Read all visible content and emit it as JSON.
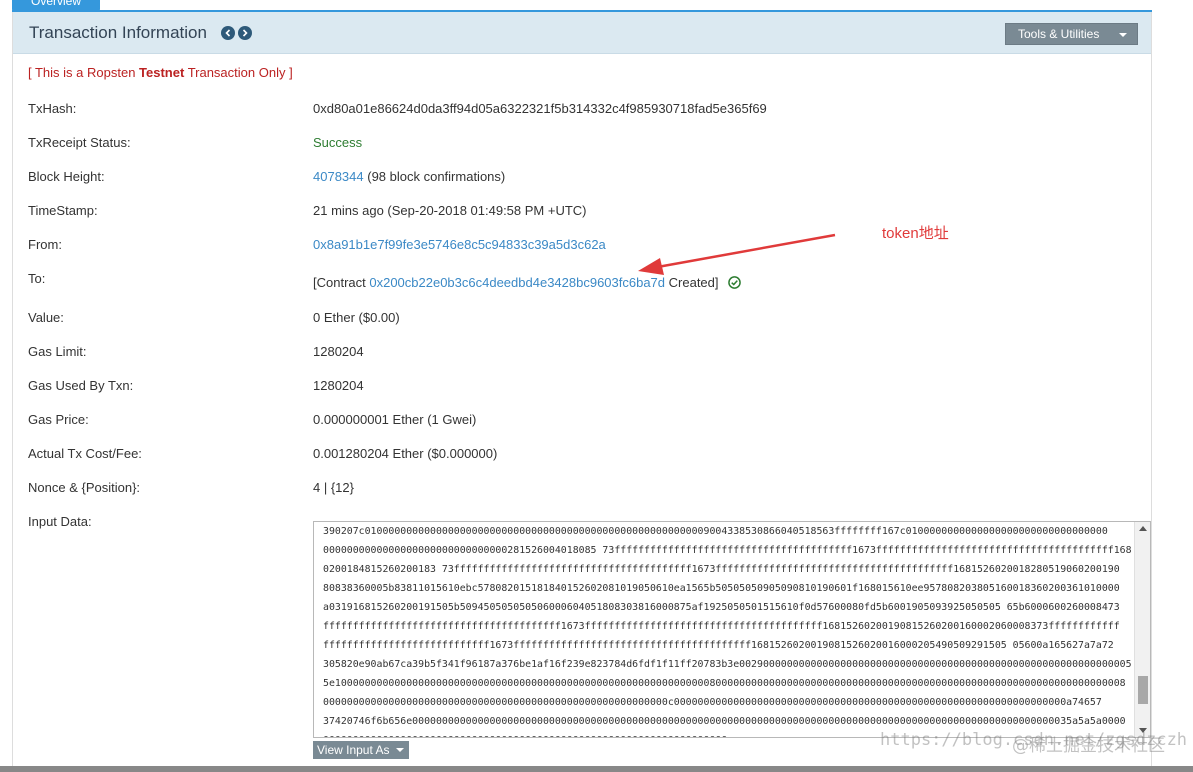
{
  "tab": {
    "label": "Overview"
  },
  "header": {
    "title": "Transaction Information",
    "tools_label": "Tools & Utilities"
  },
  "notice": {
    "prefix": "[ This is a Ropsten ",
    "bold": "Testnet",
    "suffix": " Transaction Only ]"
  },
  "rows": {
    "txhash": {
      "label": "TxHash:",
      "value": "0xd80a01e86624d0da3ff94d05a6322321f5b314332c4f985930718fad5e365f69"
    },
    "status": {
      "label": "TxReceipt Status:",
      "value": "Success"
    },
    "block": {
      "label": "Block Height:",
      "link": "4078344",
      "suffix": " (98 block confirmations)"
    },
    "timestamp": {
      "label": "TimeStamp:",
      "value": "21 mins ago (Sep-20-2018 01:49:58 PM +UTC)"
    },
    "from": {
      "label": "From:",
      "value": "0x8a91b1e7f99fe3e5746e8c5c94833c39a5d3c62a"
    },
    "to": {
      "label": "To:",
      "prefix": "[Contract ",
      "link": "0x200cb22e0b3c6c4deedbd4e3428bc9603fc6ba7d",
      "suffix": " Created]"
    },
    "value": {
      "label": "Value:",
      "value": "0 Ether ($0.00)"
    },
    "gas_limit": {
      "label": "Gas Limit:",
      "value": "1280204"
    },
    "gas_used": {
      "label": "Gas Used By Txn:",
      "value": "1280204"
    },
    "gas_price": {
      "label": "Gas Price:",
      "value": "0.000000001 Ether (1 Gwei)"
    },
    "fee": {
      "label": "Actual Tx Cost/Fee:",
      "value": "0.001280204 Ether ($0.000000)"
    },
    "nonce": {
      "label": "Nonce & {Position}:",
      "value": "4 | {12}"
    },
    "input": {
      "label": "Input Data:"
    }
  },
  "input_data": "390207c0100000000000000000000000000000000000000000000000000000009004338530866040518563ffffffff167c0100000000000000000000000000000000\n0000000000000000000000000000000281526004018085 73ffffffffffffffffffffffffffffffffffffffff1673ffffffffffffffffffffffffffffffffffffffff1681526\n0200184815260200183 73ffffffffffffffffffffffffffffffffffffffff1673ffffffffffffffffffffffffffffffffffffffff1681526020018280519060200190\n80838360005b83811015610ebc578082015181840152602081019050610ea1565b50505050905090810190601f168015610ee957808203805160018360200361010000\na031916815260200191505b509450505050506000604051808303816000875af1925050501515610f0d57600080fd5b6001905093925050505 65b6000600260008473\nffffffffffffffffffffffffffffffffffffffff1673ffffffffffffffffffffffffffffffffffffffff16815260200190815260200160002060008373ffffffffffff\nffffffffffffffffffffffffffff1673ffffffffffffffffffffffffffffffffffffffff1681526020019081526020016000205490509291505 05600a165627a7a72\n305820e90ab67ca39b5f341f96187a376be1af16f239e823784d6fdf1f11ff20783b3e002900000000000000000000000000000000000000000000000000000000000005f\n5e1000000000000000000000000000000000000000000000000000000000000008000000000000000000000000000000000000000000000000000000000000000000008\n0000000000000000000000000000000000000000000000000000000000c000000000000000000000000000000000000000000000000000000000000000000a74657\n37420746f6b656e000000000000000000000000000000000000000000000000000000000000000000000000000000000000000000000000000000000000035a5a5a0000\n00000000000000000000000000000000000000000000000000000000000000000000",
  "view_input_label": "View Input As",
  "annotation": "token地址",
  "watermark": "https://blog.csdn.net/zgsdzczh",
  "watermark2": "@稀土掘金技术社区",
  "colors": {
    "accent": "#3598dc",
    "link": "#3b89c6",
    "success": "#2e7d32",
    "annotation": "#e03a3a"
  }
}
